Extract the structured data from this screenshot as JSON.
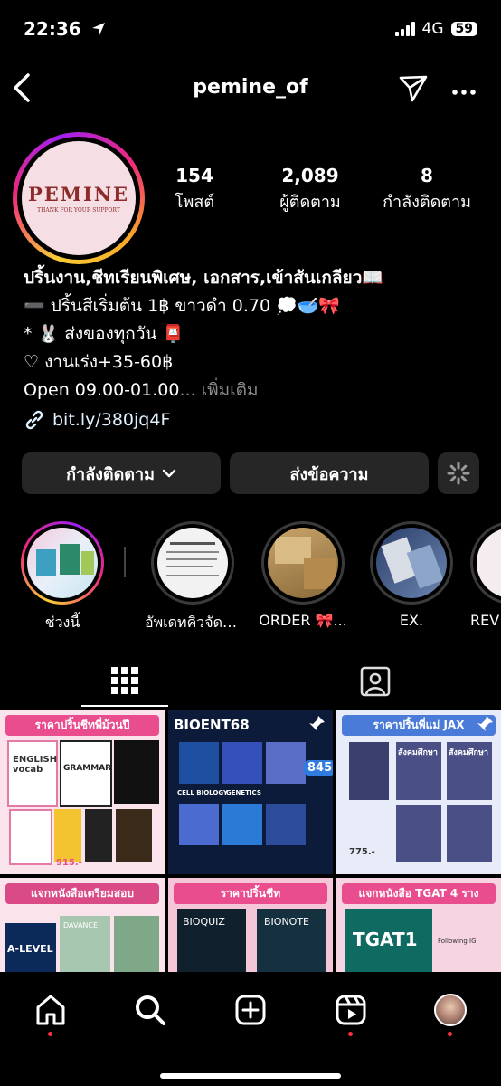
{
  "status": {
    "time": "22:36",
    "network": "4G",
    "battery": "59"
  },
  "header": {
    "username": "pemine_of"
  },
  "profile": {
    "avatar_word": "PEMINE",
    "avatar_sub": "THANK FOR YOUR SUPPORT",
    "stats": [
      {
        "num": "154",
        "label": "โพสต์"
      },
      {
        "num": "2,089",
        "label": "ผู้ติดตาม"
      },
      {
        "num": "8",
        "label": "กำลังติดตาม"
      }
    ],
    "bio": [
      "ปริ้นงาน,ชีทเรียนพิเศษ, เอกสาร,เข้าสันเกลียว📖",
      "➖ ปริ้นสีเริ่มต้น 1฿ ขาวดำ 0.70 💭🥣🎀",
      "* 🐰 ส่งของทุกวัน 📮",
      "♡ งานเร่ง+35-60฿"
    ],
    "bio_last": "Open 09.00-01.00",
    "more": "... เพิ่มเติม",
    "link": "bit.ly/380jq4F"
  },
  "buttons": {
    "following": "กำลังติดตาม",
    "message": "ส่งข้อความ"
  },
  "highlights": [
    {
      "label": "ช่วงนี้"
    },
    {
      "label": "อัพเดทคิวจัดส่..."
    },
    {
      "label": "ORDER 🎀..."
    },
    {
      "label": "EX."
    },
    {
      "label": "REV"
    }
  ],
  "posts": [
    {
      "head": "ราคาปริ้นชีทพี่ม้วนปี",
      "line1": "ENGLISH vocab",
      "line2": "GRAMMAR",
      "price": "915.-"
    },
    {
      "head": "BIOENT68",
      "line1": "CELL BIOLOGY",
      "line2": "GENETICS",
      "price": "845"
    },
    {
      "head": "ราคาปริ้นพี่แม่ JAX",
      "line1": "สังคมศึกษา",
      "line2": "สังคมศึกษา",
      "price": "775.-"
    },
    {
      "head": "แจกหนังสือเตรียมสอบ",
      "line1": "A-LEVEL",
      "line2": "DAVANCE",
      "price": ""
    },
    {
      "head": "ราคาปริ้นชีท",
      "line1": "BIOQUIZ",
      "line2": "BIONOTE",
      "price": ""
    },
    {
      "head": "แจกหนังสือ TGAT 4 ราง",
      "line1": "TGAT1",
      "line2": "Following IG",
      "price": ""
    }
  ],
  "colors": {
    "accent_pink": "#ee2a7b",
    "button_bg": "#262626",
    "link": "#e0f1ff",
    "notif_dot": "#ff3040"
  }
}
